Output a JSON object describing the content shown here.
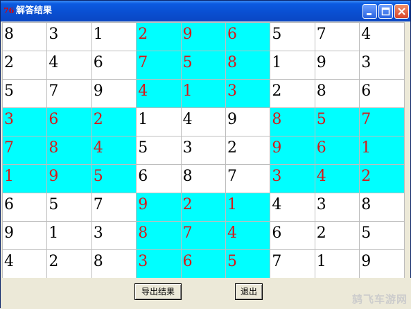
{
  "window": {
    "title": "解答结果",
    "app_icon_text": "76",
    "minimize_icon": "minimize-icon",
    "maximize_icon": "maximize-icon",
    "close_icon": "close-icon"
  },
  "grid": {
    "values": [
      [
        "8",
        "3",
        "1",
        "2",
        "9",
        "6",
        "5",
        "7",
        "4"
      ],
      [
        "2",
        "4",
        "6",
        "7",
        "5",
        "8",
        "1",
        "9",
        "3"
      ],
      [
        "5",
        "7",
        "9",
        "4",
        "1",
        "3",
        "2",
        "8",
        "6"
      ],
      [
        "3",
        "6",
        "2",
        "1",
        "4",
        "9",
        "8",
        "5",
        "7"
      ],
      [
        "7",
        "8",
        "4",
        "5",
        "3",
        "2",
        "9",
        "6",
        "1"
      ],
      [
        "1",
        "9",
        "5",
        "6",
        "8",
        "7",
        "3",
        "4",
        "2"
      ],
      [
        "6",
        "5",
        "7",
        "9",
        "2",
        "1",
        "4",
        "3",
        "8"
      ],
      [
        "9",
        "1",
        "3",
        "8",
        "7",
        "4",
        "6",
        "2",
        "5"
      ],
      [
        "4",
        "2",
        "8",
        "3",
        "6",
        "5",
        "7",
        "1",
        "9"
      ]
    ],
    "colors": {
      "highlight_bg": "#00ffff",
      "highlight_text": "#d81818",
      "plain_bg": "#ffffff",
      "plain_text": "#000000"
    }
  },
  "buttons": {
    "export_label": "导出结果",
    "exit_label": "退出"
  },
  "watermark": "鸫飞车游网"
}
